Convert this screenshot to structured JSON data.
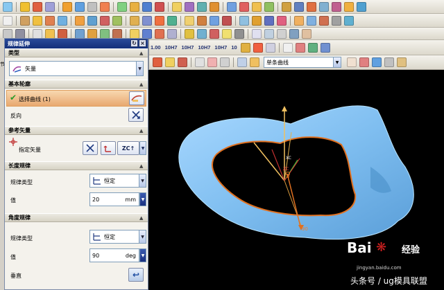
{
  "toolbar": {
    "gdt_labels": [
      "1.00",
      "10H7",
      "10H7",
      "10H7",
      "10H7",
      "10"
    ]
  },
  "viewport_toolbar": {
    "filter_value": "单条曲线"
  },
  "left_edge_text": "节",
  "dialog": {
    "title": "规律延伸",
    "sections": {
      "type": {
        "header": "类型",
        "value": "矢量"
      },
      "base_profile": {
        "header": "基本轮廓",
        "select_label": "选择曲线 (1)",
        "reverse_label": "反向"
      },
      "ref_vector": {
        "header": "参考矢量",
        "specify_label": "指定矢量"
      },
      "length_law": {
        "header": "长度规律",
        "law_type_label": "规律类型",
        "law_type_value": "恒定",
        "value_label": "值",
        "value": "20",
        "unit": "mm"
      },
      "angle_law": {
        "header": "角度规律",
        "law_type_label": "规律类型",
        "law_type_value": "恒定",
        "value_label": "值",
        "value": "90",
        "unit": "deg",
        "vertical_label": "垂直"
      }
    }
  },
  "viewport": {
    "xc_label": "XC",
    "zc_label": "ZC",
    "dim_label": "0",
    "dim_label_2": "90"
  },
  "watermark": {
    "logo": "Bai",
    "logo_suffix": "经验",
    "url": "jingyan.baidu.com",
    "account": "头条号 / ug模具联盟"
  },
  "colors": {
    "surface": "#7fbef0",
    "profile": "#e07020",
    "title_bar": "#1e3e8a"
  }
}
